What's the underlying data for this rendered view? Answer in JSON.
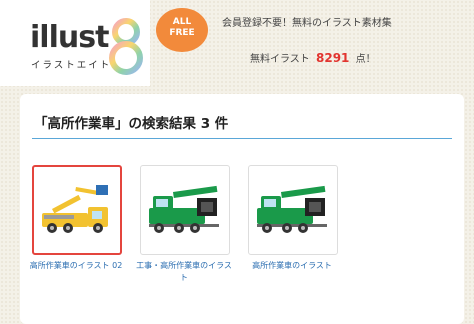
{
  "header": {
    "logo_text": "illust",
    "logo_sub": "イラストエイト",
    "badge_line1": "ALL",
    "badge_line2": "FREE",
    "tagline": "会員登録不要！無料のイラスト素材集",
    "count_prefix": "無料イラスト",
    "count_value": "8291",
    "count_suffix": "点！"
  },
  "search": {
    "title": "「高所作業車」の検索結果 3 件"
  },
  "results": [
    {
      "caption": "高所作業車のイラスト 02",
      "selected": true,
      "colors": {
        "body": "#f2c230",
        "boom": "#f2c230",
        "bucket": "#2e6fb5"
      }
    },
    {
      "caption": "工事・高所作業車のイラスト",
      "selected": false,
      "colors": {
        "body": "#1a9a4a",
        "boom": "#222222"
      }
    },
    {
      "caption": "高所作業車のイラスト",
      "selected": false,
      "colors": {
        "body": "#1a9a4a",
        "boom": "#222222"
      }
    }
  ],
  "colors": {
    "accent": "#5aa7d8",
    "count": "#e2342f",
    "selected_border": "#e4453e",
    "badge": "#f28a3b"
  }
}
